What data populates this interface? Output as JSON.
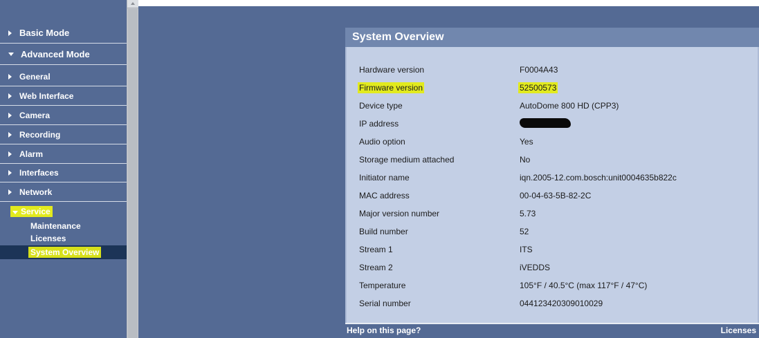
{
  "sidebar": {
    "basic_mode": "Basic Mode",
    "advanced_mode": "Advanced Mode",
    "items": [
      {
        "label": "General"
      },
      {
        "label": "Web Interface"
      },
      {
        "label": "Camera"
      },
      {
        "label": "Recording"
      },
      {
        "label": "Alarm"
      },
      {
        "label": "Interfaces"
      },
      {
        "label": "Network"
      },
      {
        "label": "Service"
      }
    ],
    "service_children": [
      {
        "label": "Maintenance"
      },
      {
        "label": "Licenses"
      },
      {
        "label": "System Overview"
      }
    ],
    "highlight_color": "#e2ea1e"
  },
  "panel": {
    "title": "System Overview",
    "rows": [
      {
        "label": "Hardware version",
        "value": "F0004A43"
      },
      {
        "label": "Firmware version",
        "value": "52500573"
      },
      {
        "label": "Device type",
        "value": "AutoDome 800 HD (CPP3)"
      },
      {
        "label": "IP address",
        "value": ""
      },
      {
        "label": "Audio option",
        "value": "Yes"
      },
      {
        "label": "Storage medium attached",
        "value": "No"
      },
      {
        "label": "Initiator name",
        "value": "iqn.2005-12.com.bosch:unit0004635b822c"
      },
      {
        "label": "MAC address",
        "value": "00-04-63-5B-82-2C"
      },
      {
        "label": "Major version number",
        "value": "5.73"
      },
      {
        "label": "Build number",
        "value": "52"
      },
      {
        "label": "Stream 1",
        "value": "ITS"
      },
      {
        "label": "Stream 2",
        "value": "iVEDDS"
      },
      {
        "label": "Temperature",
        "value": "105°F / 40.5°C (max 117°F / 47°C)"
      },
      {
        "label": "Serial number",
        "value": "044123420309010029"
      }
    ],
    "footer": {
      "help": "Help on this page?",
      "licenses": "Licenses"
    }
  }
}
